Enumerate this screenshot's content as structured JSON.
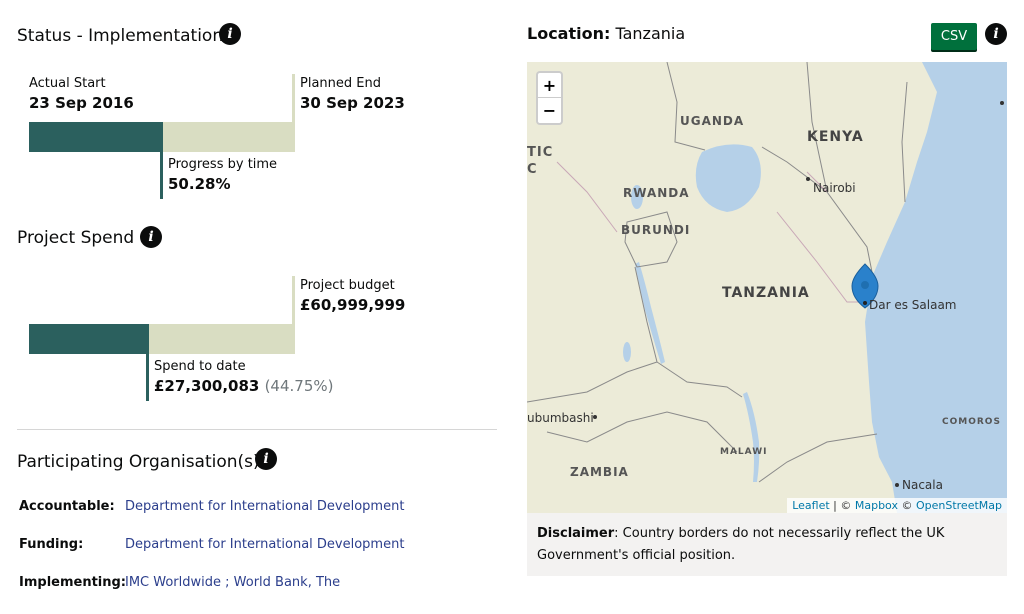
{
  "status": {
    "title": "Status - Implementation",
    "actual_start_label": "Actual Start",
    "actual_start_value": "23 Sep 2016",
    "planned_end_label": "Planned End",
    "planned_end_value": "30 Sep 2023",
    "progress_label": "Progress by time",
    "progress_value": "50.28%",
    "progress_fraction": 0.5028
  },
  "spend": {
    "title": "Project Spend",
    "budget_label": "Project budget",
    "budget_value": "£60,999,999",
    "spend_label": "Spend to date",
    "spend_value": "£27,300,083",
    "spend_percent": "(44.75%)",
    "spend_fraction": 0.4475
  },
  "orgs": {
    "title": "Participating Organisation(s)",
    "rows": [
      {
        "label": "Accountable:",
        "value": "Department for International Development"
      },
      {
        "label": "Funding:",
        "value": "Department for International Development"
      },
      {
        "label": "Implementing:",
        "value": "IMC Worldwide ; World Bank, The"
      }
    ]
  },
  "location": {
    "label": "Location:",
    "value": "Tanzania",
    "csv_label": "CSV",
    "zoom_in": "+",
    "zoom_out": "−",
    "map_labels": {
      "uganda": "UGANDA",
      "kenya": "KENYA",
      "nairobi": "Nairobi",
      "rwanda": "RWANDA",
      "burundi": "BURUNDI",
      "tanzania": "TANZANIA",
      "dar": "Dar es Salaam",
      "zambia": "ZAMBIA",
      "malawi": "MALAWI",
      "comoros": "COMOROS",
      "nacala": "Nacala",
      "lubumbashi": "ubumbashi",
      "tic": "TIC",
      "c": "C"
    },
    "attribution": {
      "leaflet": "Leaflet",
      "sep1": " | © ",
      "mapbox": "Mapbox",
      "sep2": " © ",
      "osm": "OpenStreetMap"
    },
    "disclaimer_label": "Disclaimer",
    "disclaimer_text": ": Country borders do not necessarily reflect the UK Government's official position."
  },
  "colors": {
    "bar_fill": "#2b605e",
    "bar_bg": "#d9ddc2",
    "link": "#2b3e8c",
    "csv_green": "#00703c",
    "sea": "#b5d0e8"
  }
}
